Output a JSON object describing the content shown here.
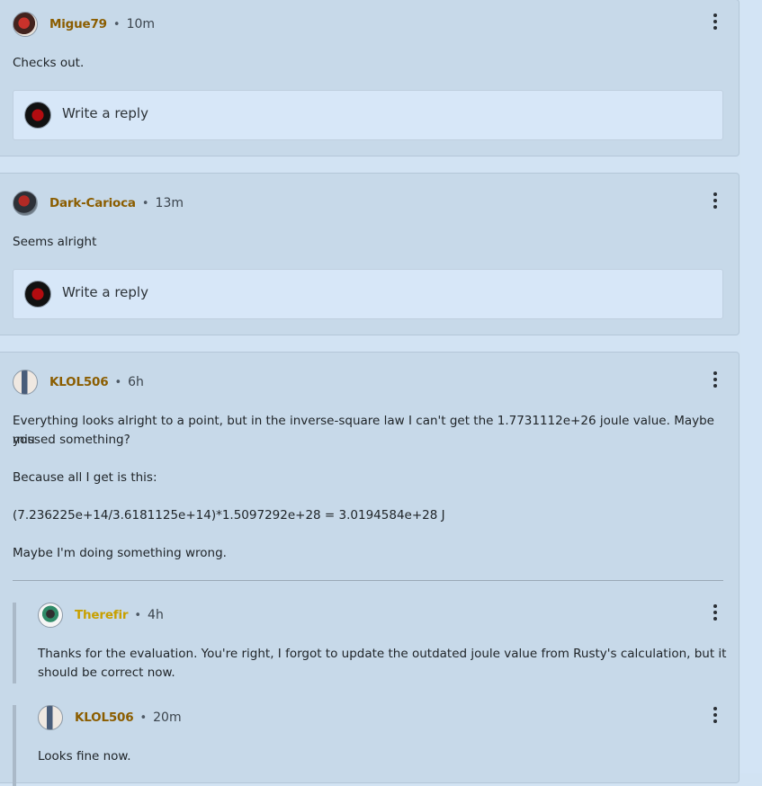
{
  "comments": [
    {
      "username": "Migue79",
      "time": "10m",
      "body": "Checks out.",
      "avatar_icon": "user-avatar-icon",
      "reply_placeholder": "Write a reply"
    },
    {
      "username": "Dark-Carioca",
      "time": "13m",
      "body": "Seems alright",
      "avatar_icon": "user-avatar-icon",
      "reply_placeholder": "Write a reply"
    },
    {
      "username": "KLOL506",
      "time": "6h",
      "body_lines": [
        "Everything looks alright to a point, but in the inverse-square law I can't get the 1.7731112e+26 joule value. Maybe you",
        "missed something?",
        "Because all I get is this:",
        "(7.236225e+14/3.6181125e+14)*1.5097292e+28 = 3.0194584e+28 J",
        "Maybe I'm doing something wrong."
      ],
      "replies": [
        {
          "username": "Therefir",
          "time": "4h",
          "body_lines": [
            "Thanks for the evaluation. You're right, I forgot to update the outdated joule value from Rusty's calculation, but it",
            "should be correct now."
          ]
        },
        {
          "username": "KLOL506",
          "time": "20m",
          "body_lines": [
            "Looks fine now."
          ]
        }
      ]
    }
  ],
  "ui": {
    "separator": "•",
    "more_icon": "more-vertical-icon",
    "colors": {
      "page_bg": "#d2e3f3",
      "card_bg": "#c7d9e9",
      "username": "#8b5d00",
      "username_mod": "#c8a000"
    }
  }
}
